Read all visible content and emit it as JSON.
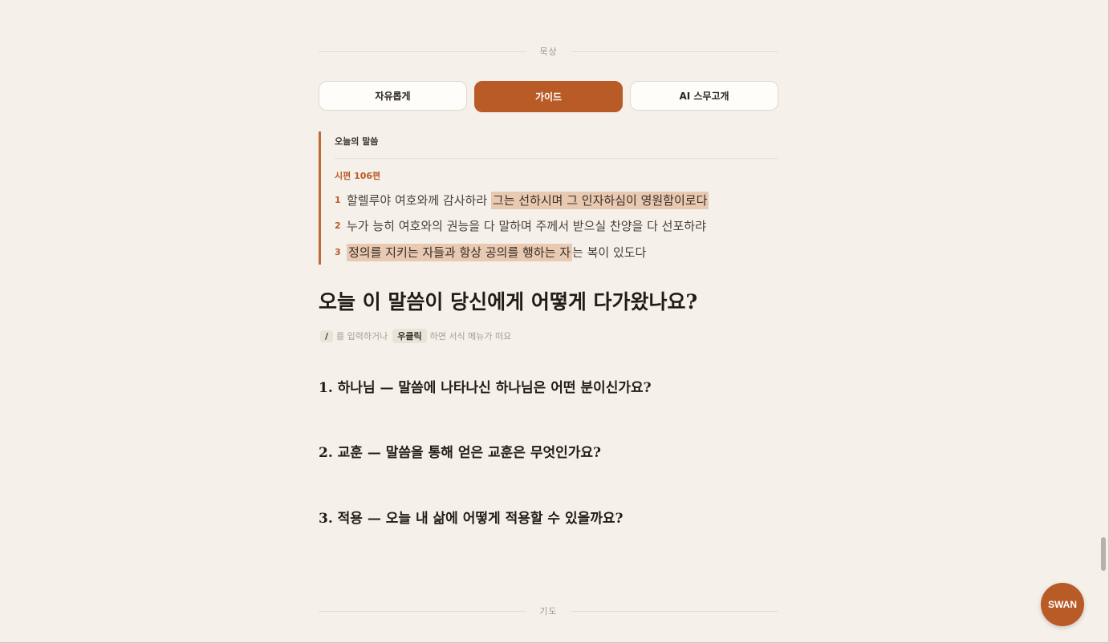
{
  "sections": {
    "meditation_label": "묵상",
    "prayer_label": "기도"
  },
  "tabs": [
    {
      "label": "자유롭게",
      "active": false
    },
    {
      "label": "가이드",
      "active": true
    },
    {
      "label": "AI 스무고개",
      "active": false
    }
  ],
  "scripture": {
    "heading": "오늘의 말씀",
    "reference": "시편 106편",
    "verses": [
      {
        "num": "1",
        "plain": "할렐루야 여호와께 감사하라 ",
        "highlight": "그는 선하시며 그 인자하심이 영원함이로다",
        "rest": ""
      },
      {
        "num": "2",
        "plain": "누가 능히 여호와의 권능을 다 말하며 주께서 받으실 찬양을 다 선포하랴",
        "highlight": "",
        "rest": ""
      },
      {
        "num": "3",
        "plain": "",
        "highlight": "정의를 지키는 자들과 항상 공의를 행하는 자",
        "rest": "는 복이 있도다"
      }
    ]
  },
  "question": {
    "title": "오늘 이 말씀이 당신에게 어떻게 다가왔나요?",
    "hint_key1": "/",
    "hint_text1": "를 입력하거나",
    "hint_key2": "우클릭",
    "hint_text2": "하면 서식 메뉴가 떠요"
  },
  "prompts": [
    "1. 하나님 — 말씀에 나타나신 하나님은 어떤 분이신가요?",
    "2. 교훈 — 말씀을 통해 얻은 교훈은 무엇인가요?",
    "3. 적용 — 오늘 내 삶에 어떻게 적용할 수 있을까요?"
  ],
  "fab": {
    "label": "SWAN"
  },
  "colors": {
    "background": "#f5f0e9",
    "accent": "#b95b27",
    "highlight": "#e8c9b1"
  }
}
